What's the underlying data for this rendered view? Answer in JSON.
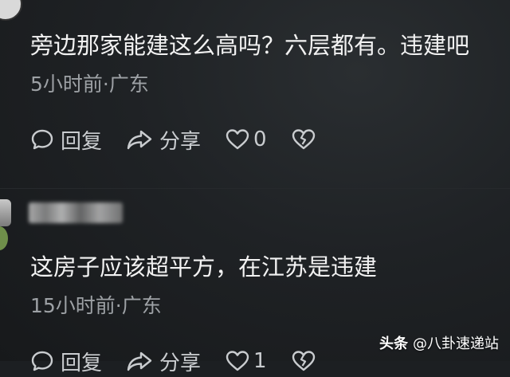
{
  "comment1": {
    "text": "旁边那家能建这么高吗？六层都有。违建吧",
    "meta": "5小时前·广东",
    "reply_label": "回复",
    "share_label": "分享",
    "like_count": "0"
  },
  "comment2": {
    "text": "这房子应该超平方，在江苏是违建",
    "meta": "15小时前·广东",
    "reply_label": "回复",
    "share_label": "分享",
    "like_count": "1"
  },
  "watermark": {
    "brand": "头条",
    "handle": "@八卦速递站"
  },
  "icons": {
    "reply": "comment-bubble-icon",
    "share": "share-arrow-icon",
    "like": "heart-icon",
    "dislike": "broken-heart-icon"
  }
}
